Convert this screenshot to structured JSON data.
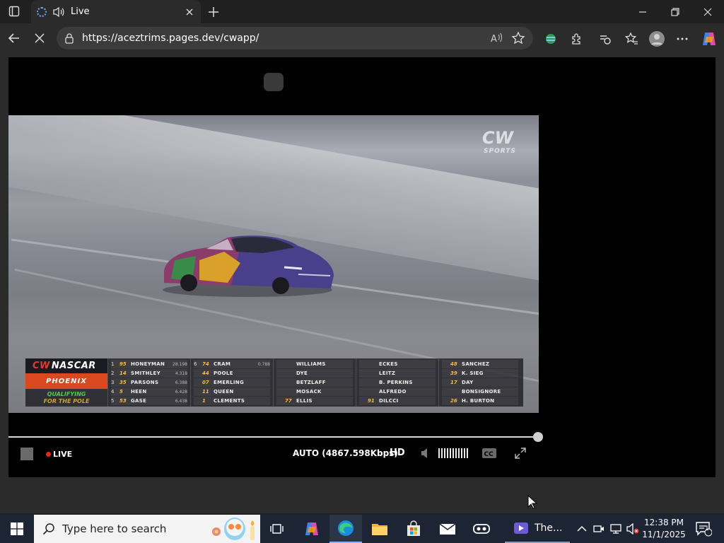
{
  "browser": {
    "tab_title": "Live",
    "url": "https://aceztrims.pages.dev/cwapp/"
  },
  "video": {
    "broadcaster_logo": "CW SPORTS",
    "scoreboard": {
      "series": "NASCAR",
      "track": "PHOENIX",
      "session_line1": "QUALIFYING",
      "session_line2": "FOR THE POLE",
      "columns": [
        [
          {
            "pos": "1",
            "num": "95",
            "name": "HONEYMAN",
            "time": "28.198"
          },
          {
            "pos": "2",
            "num": "14",
            "name": "SMITHLEY",
            "time": "4.318"
          },
          {
            "pos": "3",
            "num": "35",
            "name": "PARSONS",
            "time": "6.388"
          },
          {
            "pos": "4",
            "num": "5",
            "name": "HEEN",
            "time": "6.428"
          },
          {
            "pos": "5",
            "num": "53",
            "name": "GASE",
            "time": "6.438"
          }
        ],
        [
          {
            "pos": "6",
            "num": "74",
            "name": "CRAM",
            "time": "0.788"
          },
          {
            "pos": "",
            "num": "44",
            "name": "POOLE",
            "time": ""
          },
          {
            "pos": "",
            "num": "07",
            "name": "EMERLING",
            "time": ""
          },
          {
            "pos": "",
            "num": "11",
            "name": "QUEEN",
            "time": ""
          },
          {
            "pos": "",
            "num": "1",
            "name": "CLEMENTS",
            "time": ""
          }
        ],
        [
          {
            "pos": "",
            "num": "",
            "name": "WILLIAMS",
            "time": ""
          },
          {
            "pos": "",
            "num": "",
            "name": "DYE",
            "time": ""
          },
          {
            "pos": "",
            "num": "",
            "name": "BETZLAFF",
            "time": ""
          },
          {
            "pos": "",
            "num": "",
            "name": "MOSACK",
            "time": ""
          },
          {
            "pos": "",
            "num": "77",
            "name": "ELLIS",
            "time": ""
          }
        ],
        [
          {
            "pos": "",
            "num": "",
            "name": "ECKES",
            "time": ""
          },
          {
            "pos": "",
            "num": "",
            "name": "LEITZ",
            "time": ""
          },
          {
            "pos": "",
            "num": "",
            "name": "B. PERKINS",
            "time": ""
          },
          {
            "pos": "",
            "num": "",
            "name": "ALFREDO",
            "time": ""
          },
          {
            "pos": "",
            "num": "91",
            "name": "DILCCI",
            "time": ""
          }
        ],
        [
          {
            "pos": "",
            "num": "48",
            "name": "SANCHEZ",
            "time": ""
          },
          {
            "pos": "",
            "num": "39",
            "name": "K. SIEG",
            "time": ""
          },
          {
            "pos": "",
            "num": "17",
            "name": "DAY",
            "time": ""
          },
          {
            "pos": "",
            "num": "",
            "name": "BONSIGNORE",
            "time": ""
          },
          {
            "pos": "",
            "num": "26",
            "name": "H. BURTON",
            "time": ""
          }
        ]
      ]
    }
  },
  "controls": {
    "live_label": "LIVE",
    "quality_label": "AUTO (4867.598Kbps)",
    "hd_label": "HD"
  },
  "taskbar": {
    "search_placeholder": "Type here to search",
    "active_window_label": "The...",
    "time": "12:38 PM",
    "date": "11/1/2025",
    "notification_count": "1"
  },
  "colors": {
    "accent_blue": "#0a84ff",
    "live_red": "#e22222",
    "nascar_orange": "#d9481f"
  }
}
